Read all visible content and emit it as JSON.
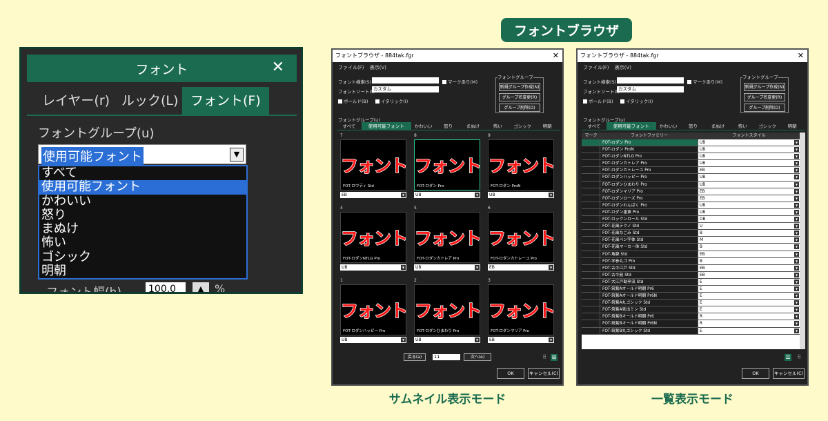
{
  "left_panel": {
    "title": "フォント",
    "close": "✕",
    "tabs": [
      "レイヤー(r)",
      "ルック(L)",
      "フォント(F)"
    ],
    "group_label": "フォントグループ(u)",
    "selected": "使用可能フォント",
    "options": [
      "すべて",
      "使用可能フォント",
      "かわいい",
      "怒り",
      "まぬけ",
      "怖い",
      "ゴシック",
      "明朝"
    ],
    "width_label": "フォント幅(h)",
    "width_value": "100.0",
    "width_unit": "%"
  },
  "badge": "フォントブラウザ",
  "thumb_dialog": {
    "title": "フォントブラウザ - 884tak.fgr",
    "menu": "ファイル(F) 表示(V)",
    "search_label": "フォント検索(S)",
    "sort_label": "フォントソート(t)",
    "sort_value": "カスタム",
    "mark_label": "マークあり(M)",
    "bold_label": "ボールド(B)",
    "italic_label": "イタリック(I)",
    "group_box": "フォントグループ",
    "group_buttons": [
      "新規グループ作成(N)",
      "グループ名変更(R)",
      "グループ削除(D)"
    ],
    "group_label": "フォントグループ(u)",
    "tabs": [
      "すべて",
      "使用可能フォント",
      "かわいい",
      "怒り",
      "まぬけ",
      "怖い",
      "ゴシック",
      "明朝"
    ],
    "sample": "フォント",
    "cells": [
      {
        "num": "7",
        "name": "FOT-ロウディ Std",
        "style": "EB"
      },
      {
        "num": "8",
        "name": "FOT-ロダン Pro",
        "style": "UB"
      },
      {
        "num": "9",
        "name": "FOT-ロダン ProN",
        "style": "UB"
      },
      {
        "num": "4",
        "name": "FOT-ロダンNTLG Pro",
        "style": "UB"
      },
      {
        "num": "5",
        "name": "FOT-ロダンカトレア Pro",
        "style": "UB"
      },
      {
        "num": "6",
        "name": "FOT-ロダンカトレーユ Pro",
        "style": "EB"
      },
      {
        "num": "1",
        "name": "FOT-ロダンハッピー Pro",
        "style": "UB"
      },
      {
        "num": "2",
        "name": "FOT-ロダンひまわり Pro",
        "style": "UB"
      },
      {
        "num": "3",
        "name": "FOT-ロダンマリア Pro",
        "style": "EB"
      }
    ],
    "prev": "戻る(a)",
    "page": "11",
    "next": "次へ(e)",
    "ok": "OK",
    "cancel": "キャンセル(C)"
  },
  "list_dialog": {
    "title": "フォントブラウザ - 884tak.fgr",
    "menu": "ファイル(F) 表示(V)",
    "search_label": "フォント検索(S)",
    "sort_label": "フォントソート(t)",
    "sort_value": "カスタム",
    "mark_label": "マークあり(M)",
    "bold_label": "ボールド(B)",
    "italic_label": "イタリック(I)",
    "group_box": "フォントグループ",
    "group_buttons": [
      "新規グループ作成(N)",
      "グループ名変更(R)",
      "グループ削除(D)"
    ],
    "group_label": "フォントグループ(u)",
    "tabs": [
      "すべて",
      "使用可能フォント",
      "かわいい",
      "怒り",
      "まぬけ",
      "怖い",
      "ゴシック",
      "明朝"
    ],
    "columns": [
      "マーク",
      "フォントファミリー",
      "フォントスタイル"
    ],
    "rows": [
      {
        "name": "FOT-ロダン Pro",
        "style": "UB"
      },
      {
        "name": "FOT-ロダン ProN",
        "style": "UB"
      },
      {
        "name": "FOT-ロダンNTLG Pro",
        "style": "UB"
      },
      {
        "name": "FOT-ロダンカトレア Pro",
        "style": "UB"
      },
      {
        "name": "FOT-ロダンカトレーユ Pro",
        "style": "EB"
      },
      {
        "name": "FOT-ロダンハッピー Pro",
        "style": "UB"
      },
      {
        "name": "FOT-ロダンひまわり Pro",
        "style": "UB"
      },
      {
        "name": "FOT-ロダンマリア Pro",
        "style": "EB"
      },
      {
        "name": "FOT-ロダンローズ Pro",
        "style": "EB"
      },
      {
        "name": "FOT-ロダンわんぱく Pro",
        "style": "UB"
      },
      {
        "name": "FOT-ロダン墨東 Pro",
        "style": "UB"
      },
      {
        "name": "FOT-ロックンロール Std",
        "style": "DB"
      },
      {
        "name": "FOT-花風テクノ Std",
        "style": "U"
      },
      {
        "name": "FOT-花風なごみ Std",
        "style": "B"
      },
      {
        "name": "FOT-花風ペン字体 Std",
        "style": "M"
      },
      {
        "name": "FOT-花風マーカー体 Std",
        "style": "B"
      },
      {
        "name": "FOT-角隷 Std",
        "style": "EB"
      },
      {
        "name": "FOT-学参丸ゴ Pro",
        "style": "B"
      },
      {
        "name": "FOT-古今江戸 Std",
        "style": "EB"
      },
      {
        "name": "FOT-古今髭 Std",
        "style": "EB"
      },
      {
        "name": "FOT-大江戸勘亭流 Std",
        "style": "E"
      },
      {
        "name": "FOT-筑紫Aオールド明朝 Pr6",
        "style": "E"
      },
      {
        "name": "FOT-筑紫Aオールド明朝 Pr6N",
        "style": "E"
      },
      {
        "name": "FOT-筑紫A丸ゴシック Std",
        "style": "E"
      },
      {
        "name": "FOT-筑紫A見出ミン Std",
        "style": "E"
      },
      {
        "name": "FOT-筑紫Bオールド明朝 Pr6",
        "style": "R"
      },
      {
        "name": "FOT-筑紫Bオールド明朝 Pr6N",
        "style": "R"
      },
      {
        "name": "FOT-筑紫B丸ゴシック Std",
        "style": "E"
      }
    ],
    "ok": "OK",
    "cancel": "キャンセル(C)"
  },
  "captions": [
    "サムネイル表示モード",
    "一覧表示モード"
  ]
}
